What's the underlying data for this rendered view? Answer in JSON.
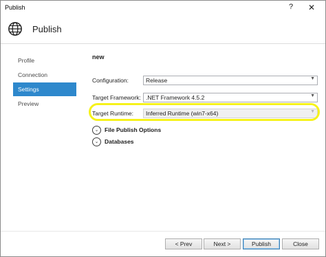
{
  "window": {
    "title": "Publish",
    "help_glyph": "?",
    "close_glyph": "✕"
  },
  "header": {
    "title": "Publish",
    "icon": "globe-icon"
  },
  "nav": {
    "items": [
      {
        "label": "Profile"
      },
      {
        "label": "Connection"
      },
      {
        "label": "Settings"
      },
      {
        "label": "Preview"
      }
    ],
    "active": "Settings"
  },
  "settings": {
    "profile_name": "new",
    "configuration": {
      "label": "Configuration:",
      "value": "Release"
    },
    "target_framework": {
      "label": "Target Framework:",
      "value": ".NET Framework 4.5.2"
    },
    "target_runtime": {
      "label": "Target Runtime:",
      "value": "Inferred Runtime (win7-x64)"
    },
    "file_publish_options": "File Publish Options",
    "databases": "Databases"
  },
  "buttons": {
    "prev": "< Prev",
    "next": "Next >",
    "publish": "Publish",
    "close": "Close"
  },
  "colors": {
    "accent": "#2e88cc",
    "highlight": "#f6f21a"
  }
}
